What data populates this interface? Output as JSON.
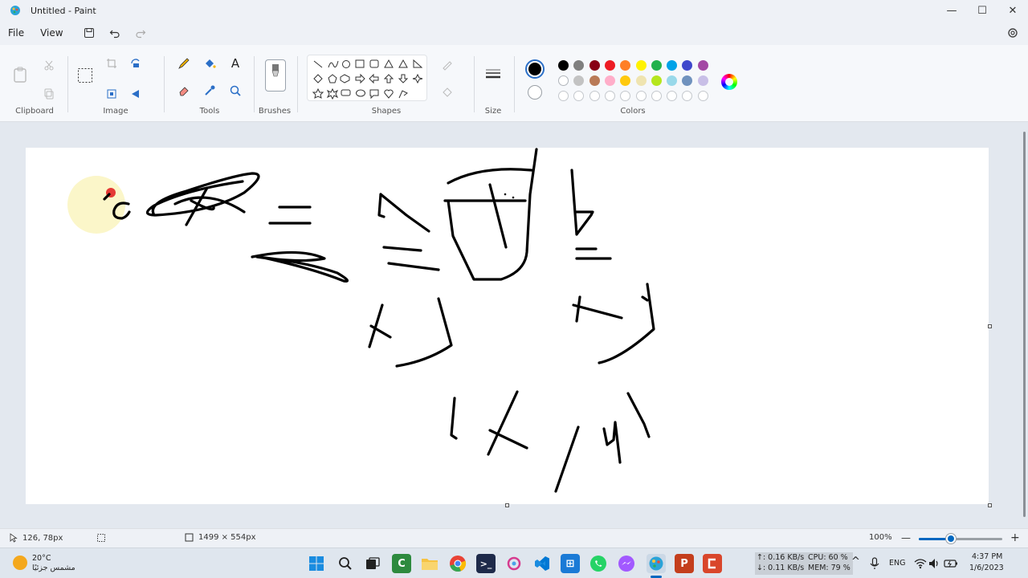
{
  "window": {
    "title": "Untitled - Paint",
    "minimize": "—",
    "maximize": "☐",
    "close": "✕"
  },
  "menu": {
    "file": "File",
    "view": "View"
  },
  "ribbon": {
    "clipboard": "Clipboard",
    "image": "Image",
    "tools": "Tools",
    "brushes": "Brushes",
    "shapes": "Shapes",
    "size": "Size",
    "colors": "Colors",
    "text_tool": "A"
  },
  "palette": {
    "primary": "#000000",
    "secondary": "#ffffff",
    "row1": [
      "#000000",
      "#7f7f7f",
      "#880015",
      "#ed1c24",
      "#ff7f27",
      "#fff200",
      "#22b14c",
      "#00a2e8",
      "#3f48cc",
      "#a349a4"
    ],
    "row2": [
      "#ffffff",
      "#c3c3c3",
      "#b97a57",
      "#ffaec9",
      "#ffc90e",
      "#efe4b0",
      "#b5e61d",
      "#99d9ea",
      "#7092be",
      "#c8bfe7"
    ]
  },
  "status": {
    "cursor_pos": "126, 78px",
    "canvas_size": "1499 × 554px",
    "zoom": "100%",
    "zoom_minus": "—",
    "zoom_plus": "+"
  },
  "taskbar": {
    "weather_temp": "20°C",
    "weather_desc": "مشمس جزئيًا",
    "net_up": "↑: 0.16 KB/s",
    "net_down": "↓: 0.11 KB/s",
    "cpu": "CPU: 60 %",
    "mem": "MEM: 79 %",
    "lang": "ENG",
    "time": "4:37 PM",
    "date": "1/6/2023",
    "chevron": "^"
  }
}
